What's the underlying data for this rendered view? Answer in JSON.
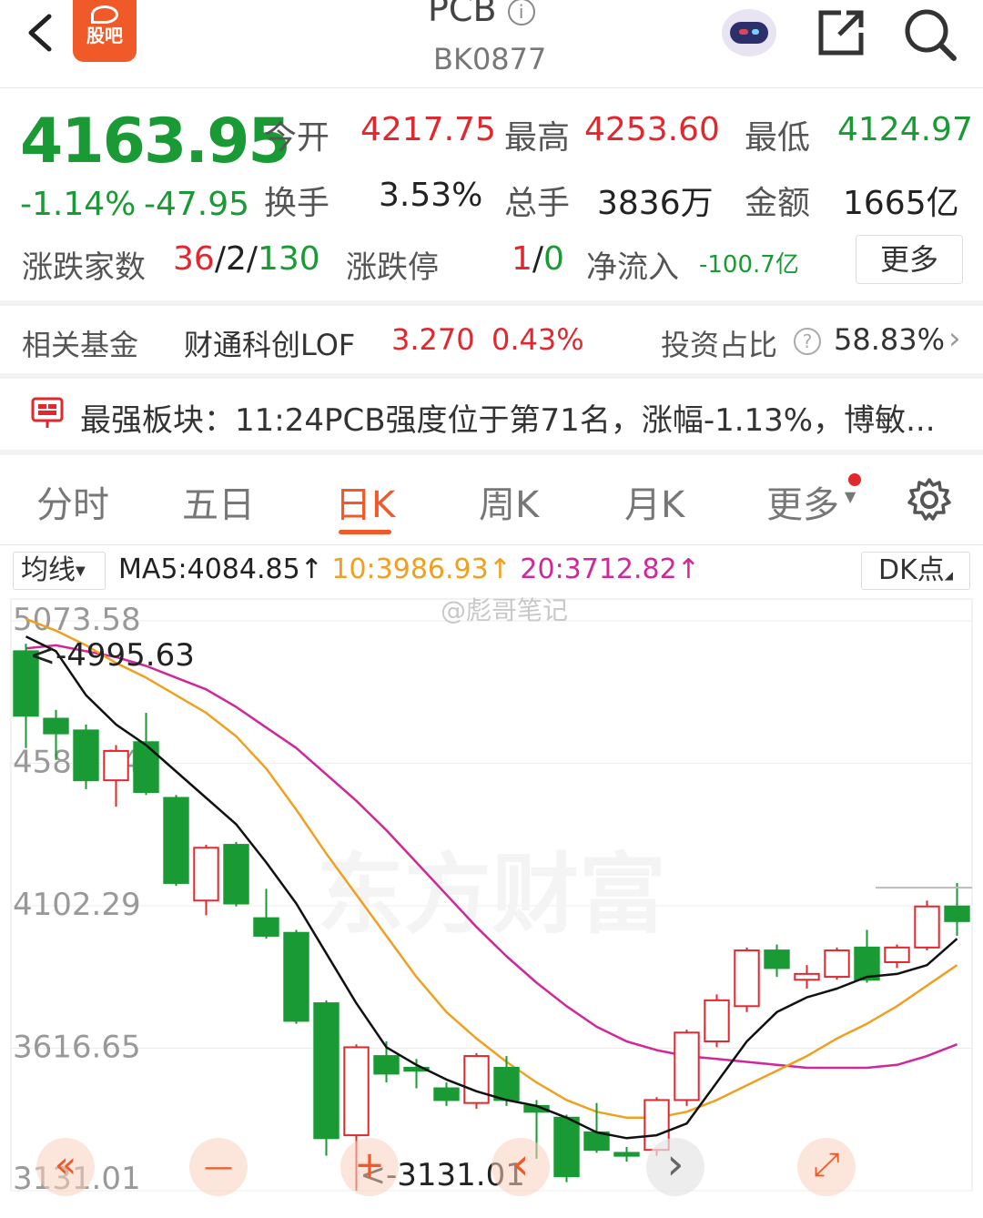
{
  "header": {
    "title": "PCB",
    "code": "BK0877",
    "guba_label": "股吧"
  },
  "quote": {
    "price": "4163.95",
    "change_pct": "-1.14%",
    "change": "-47.95",
    "fields": {
      "open_label": "今开",
      "open": "4217.75",
      "high_label": "最高",
      "high": "4253.60",
      "low_label": "最低",
      "low": "4124.97",
      "turnover_label": "换手",
      "turnover": "3.53%",
      "volume_label": "总手",
      "volume": "3836万",
      "amount_label": "金额",
      "amount": "1665亿"
    },
    "updown_label": "涨跌家数",
    "up_count": "36",
    "flat_count": "2",
    "down_count": "130",
    "limit_label": "涨跌停",
    "limit_up": "1",
    "limit_down": "0",
    "netflow_label": "净流入",
    "netflow": "-100.7亿",
    "more_label": "更多"
  },
  "fund": {
    "label": "相关基金",
    "name": "财通科创LOF",
    "nav": "3.270",
    "pct": "0.43%",
    "ratio_label": "投资占比",
    "ratio": "58.83%"
  },
  "banner": {
    "text": "最强板块：11:24PCB强度位于第71名，涨幅-1.13%，博敏..."
  },
  "tabs": [
    {
      "label": "分时"
    },
    {
      "label": "五日"
    },
    {
      "label": "日K"
    },
    {
      "label": "周K"
    },
    {
      "label": "月K"
    },
    {
      "label": "更多"
    }
  ],
  "ma_bar": {
    "selector": "均线",
    "ma5": "MA5:4084.85",
    "ma10": "10:3986.93",
    "ma20": "20:3712.82",
    "arrow": "↑",
    "dk": "DK点"
  },
  "colors": {
    "up": "#e0282e",
    "down": "#1a9a34",
    "ma5": "#111111",
    "ma10": "#f0a020",
    "ma20": "#d0279a",
    "accent": "#f05a28"
  },
  "chart_data": {
    "type": "candlestick",
    "y_ticks": [
      "5073.58",
      "4587.94",
      "4102.29",
      "3616.65",
      "3131.01"
    ],
    "ylim": [
      3131.01,
      5073.58
    ],
    "max_label": "<-4995.63",
    "min_label": "<-3131.01",
    "watermark_user": "@彪哥笔记",
    "watermark_brand": "东方财富",
    "candles": [
      {
        "o": 4970,
        "c": 4750,
        "h": 4995.63,
        "l": 4640
      },
      {
        "o": 4740,
        "c": 4690,
        "h": 4770,
        "l": 4600
      },
      {
        "o": 4700,
        "c": 4530,
        "h": 4720,
        "l": 4500
      },
      {
        "o": 4530,
        "c": 4630,
        "h": 4650,
        "l": 4440
      },
      {
        "o": 4660,
        "c": 4490,
        "h": 4760,
        "l": 4480
      },
      {
        "o": 4470,
        "c": 4180,
        "h": 4480,
        "l": 4170
      },
      {
        "o": 4120,
        "c": 4300,
        "h": 4310,
        "l": 4070
      },
      {
        "o": 4310,
        "c": 4110,
        "h": 4320,
        "l": 4100
      },
      {
        "o": 4060,
        "c": 4000,
        "h": 4160,
        "l": 3990
      },
      {
        "o": 4010,
        "c": 3710,
        "h": 4020,
        "l": 3700
      },
      {
        "o": 3770,
        "c": 3310,
        "h": 3780,
        "l": 3250
      },
      {
        "o": 3320,
        "c": 3620,
        "h": 3630,
        "l": 3131.01
      },
      {
        "o": 3590,
        "c": 3530,
        "h": 3640,
        "l": 3500
      },
      {
        "o": 3550,
        "c": 3540,
        "h": 3580,
        "l": 3480
      },
      {
        "o": 3480,
        "c": 3440,
        "h": 3500,
        "l": 3420
      },
      {
        "o": 3430,
        "c": 3590,
        "h": 3600,
        "l": 3410
      },
      {
        "o": 3550,
        "c": 3440,
        "h": 3590,
        "l": 3420
      },
      {
        "o": 3420,
        "c": 3400,
        "h": 3440,
        "l": 3240
      },
      {
        "o": 3380,
        "c": 3180,
        "h": 3390,
        "l": 3160
      },
      {
        "o": 3330,
        "c": 3270,
        "h": 3430,
        "l": 3260
      },
      {
        "o": 3260,
        "c": 3250,
        "h": 3280,
        "l": 3230
      },
      {
        "o": 3270,
        "c": 3440,
        "h": 3450,
        "l": 3250
      },
      {
        "o": 3440,
        "c": 3670,
        "h": 3680,
        "l": 3420
      },
      {
        "o": 3640,
        "c": 3780,
        "h": 3800,
        "l": 3620
      },
      {
        "o": 3760,
        "c": 3950,
        "h": 3960,
        "l": 3740
      },
      {
        "o": 3950,
        "c": 3890,
        "h": 3970,
        "l": 3860
      },
      {
        "o": 3850,
        "c": 3870,
        "h": 3900,
        "l": 3820
      },
      {
        "o": 3860,
        "c": 3950,
        "h": 3960,
        "l": 3850
      },
      {
        "o": 3960,
        "c": 3850,
        "h": 4020,
        "l": 3840
      },
      {
        "o": 3910,
        "c": 3960,
        "h": 3970,
        "l": 3890
      },
      {
        "o": 3960,
        "c": 4100,
        "h": 4120,
        "l": 3950
      },
      {
        "o": 4100,
        "c": 4050,
        "h": 4180,
        "l": 4000
      }
    ],
    "ma5": [
      5020,
      4970,
      4820,
      4720,
      4650,
      4560,
      4470,
      4380,
      4250,
      4110,
      3940,
      3770,
      3620,
      3560,
      3510,
      3470,
      3440,
      3420,
      3380,
      3330,
      3310,
      3320,
      3360,
      3500,
      3640,
      3740,
      3790,
      3820,
      3860,
      3870,
      3900,
      3990
    ],
    "ma10": [
      5080,
      5040,
      4990,
      4930,
      4880,
      4820,
      4760,
      4680,
      4570,
      4430,
      4280,
      4140,
      4000,
      3860,
      3740,
      3650,
      3570,
      3500,
      3440,
      3400,
      3380,
      3380,
      3400,
      3440,
      3490,
      3540,
      3590,
      3650,
      3700,
      3760,
      3830,
      3900
    ],
    "ma20": [
      4980,
      4990,
      4970,
      4950,
      4920,
      4880,
      4840,
      4780,
      4710,
      4640,
      4550,
      4460,
      4360,
      4250,
      4140,
      4030,
      3930,
      3840,
      3760,
      3690,
      3640,
      3610,
      3590,
      3580,
      3570,
      3560,
      3550,
      3550,
      3550,
      3560,
      3590,
      3630
    ]
  },
  "controls": {
    "rewind": "«",
    "minus": "—",
    "plus": "+",
    "prev": "‹",
    "next": "›",
    "expand": "⤢"
  }
}
